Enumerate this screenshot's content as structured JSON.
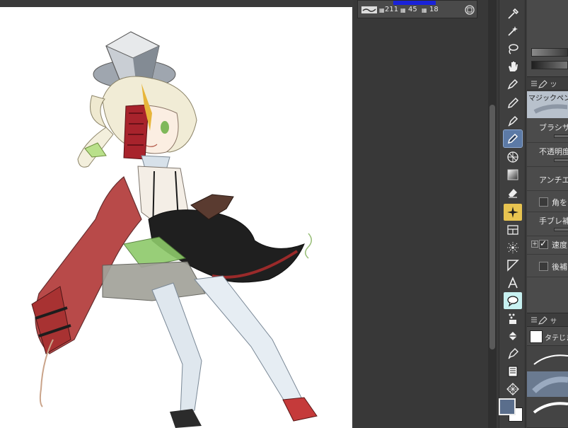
{
  "info_panel": {
    "value_a": "211",
    "value_b": "45",
    "value_c": "18"
  },
  "sub_tool_panel": {
    "tab_label": "サ"
  },
  "tool_property": {
    "subtool_name": "マジックペン",
    "brush_size_label": "ブラシサイ",
    "opacity_label": "不透明度",
    "antialias_label": "アンチエイ",
    "corner_label": "角を",
    "stabilization_label": "手ブレ補",
    "speed_label": "速度",
    "post_correction_label": "後補"
  },
  "brush_list": {
    "tab_label": "サ",
    "entry_label": "タテじま"
  },
  "tools": [
    {
      "name": "eyedropper-tool"
    },
    {
      "name": "auto-select-tool"
    },
    {
      "name": "lasso-select-tool"
    },
    {
      "name": "hand-tool"
    },
    {
      "name": "pen-tool"
    },
    {
      "name": "pencil-tool"
    },
    {
      "name": "fountain-pen-tool"
    },
    {
      "name": "marker-tool"
    },
    {
      "name": "mesh-tool"
    },
    {
      "name": "gradient-tool"
    },
    {
      "name": "eraser-tool"
    },
    {
      "name": "decoration-tool"
    },
    {
      "name": "frame-tool"
    },
    {
      "name": "ruler-tool"
    },
    {
      "name": "figure-tool"
    },
    {
      "name": "text-tool"
    },
    {
      "name": "balloon-tool"
    },
    {
      "name": "blend-tool"
    },
    {
      "name": "fill-tool"
    },
    {
      "name": "vector-pen-tool"
    },
    {
      "name": "stamp-tool"
    },
    {
      "name": "pattern-tool"
    }
  ],
  "colors": {
    "main_color": "#5a6e8c",
    "sub_color": "#ffffff",
    "active_tool_bg": "#5c7aa6",
    "highlight_tool_bg": "#e8c450"
  }
}
